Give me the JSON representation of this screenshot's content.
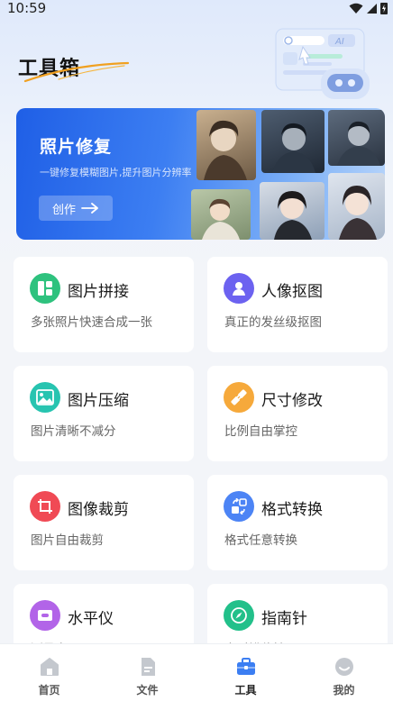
{
  "status_bar": {
    "time": "10:59"
  },
  "header": {
    "title": "工具箱"
  },
  "banner": {
    "title": "照片修复",
    "subtitle": "一键修复模糊图片,提升图片分辨率",
    "button_label": "创作"
  },
  "tools": [
    {
      "title": "图片拼接",
      "desc": "多张照片快速合成一张",
      "icon": "collage-icon",
      "color": "#2ec27e"
    },
    {
      "title": "人像抠图",
      "desc": "真正的发丝级抠图",
      "icon": "portrait-cutout-icon",
      "color": "#6c62f0"
    },
    {
      "title": "图片压缩",
      "desc": "图片清晰不减分",
      "icon": "image-compress-icon",
      "color": "#27c4b0"
    },
    {
      "title": "尺寸修改",
      "desc": "比例自由掌控",
      "icon": "resize-icon",
      "color": "#f6a93b"
    },
    {
      "title": "图像裁剪",
      "desc": "图片自由裁剪",
      "icon": "crop-icon",
      "color": "#f04a55"
    },
    {
      "title": "格式转换",
      "desc": "格式任意转换",
      "icon": "format-convert-icon",
      "color": "#4c84f5"
    },
    {
      "title": "水平仪",
      "desc": "测量水平工具",
      "icon": "level-icon",
      "color": "#b264e8"
    },
    {
      "title": "指南针",
      "desc": "实时辨位神器",
      "icon": "compass-icon",
      "color": "#22c08a"
    }
  ],
  "tabbar": {
    "items": [
      {
        "label": "首页",
        "icon": "home-icon"
      },
      {
        "label": "文件",
        "icon": "file-icon"
      },
      {
        "label": "工具",
        "icon": "toolbox-icon"
      },
      {
        "label": "我的",
        "icon": "profile-icon"
      }
    ],
    "active_index": 2
  },
  "colors": {
    "accent": "#3b7ef2",
    "tab_inactive": "#c4c8ce"
  }
}
